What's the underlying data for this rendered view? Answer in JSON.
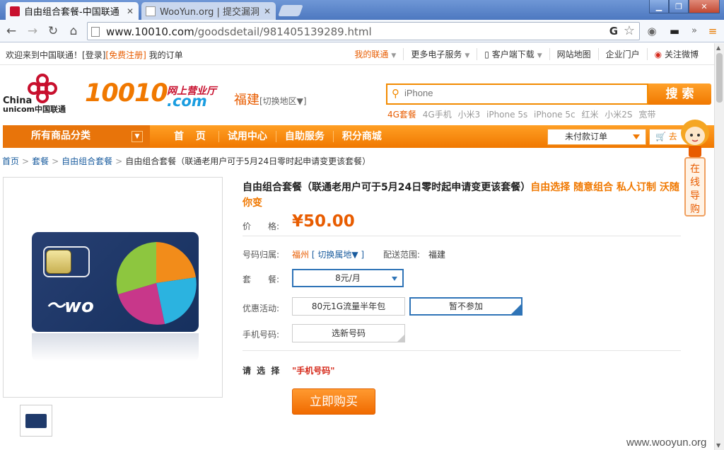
{
  "browser": {
    "tabs": [
      {
        "title": "自由组合套餐-中国联通",
        "active": true
      },
      {
        "title": "WooYun.org | 提交漏洞",
        "active": false
      }
    ],
    "url_host": "www.10010.com",
    "url_path": "/goodsdetail/981405139289.html"
  },
  "site_top": {
    "welcome": "欢迎来到中国联通！",
    "login": "[登录]",
    "register": "[免费注册]",
    "my_orders": "我的订单",
    "links": [
      "我的联通",
      "更多电子服务",
      "客户端下载",
      "网站地图",
      "企业门户",
      "关注微博"
    ]
  },
  "header": {
    "logo_en_1": "China",
    "logo_en_2": "unicom中国联通",
    "logo_number": "10010",
    "logo_sub": "网上营业厅",
    "logo_com": ".com",
    "province": "福建",
    "switch_region": "[切换地区▼]",
    "search_placeholder": "iPhone",
    "search_button": "搜 索",
    "hot_words": [
      "4G套餐",
      "4G手机",
      "小米3",
      "iPhone 5s",
      "iPhone 5c",
      "红米",
      "小米2S",
      "宽带"
    ]
  },
  "nav": {
    "all_categories": "所有商品分类",
    "items": [
      "首 页",
      "试用中心",
      "自助服务",
      "积分商城"
    ],
    "unpaid_orders": "未付款订单",
    "cart": "去"
  },
  "breadcrumb": {
    "items": [
      "首页",
      "套餐",
      "自由组合套餐"
    ],
    "current": "自由组合套餐（联通老用户可于5月24日零时起申请变更该套餐）"
  },
  "product": {
    "title": "自由组合套餐（联通老用户可于5月24日零时起申请变更该套餐）",
    "slogan": "自由选择 随意组合 私人订制 沃随你变",
    "price_label": "价　　格:",
    "price": "¥50.00",
    "location_label": "号码归属:",
    "location": "福州",
    "location_switch": "[ 切换属地▼ ]",
    "shipping_label": "配送范围:",
    "shipping": "福建",
    "plan_label": "套　　餐:",
    "plan_value": "8元/月",
    "promo_label": "优惠活动:",
    "promo_options": [
      "80元1G流量半年包",
      "暂不参加"
    ],
    "phone_label": "手机号码:",
    "phone_button": "选新号码",
    "please_select": "请 选 择",
    "missing": "\"手机号码\"",
    "buy_button": "立即购买"
  },
  "guide": {
    "text": [
      "在",
      "线",
      "导",
      "购"
    ]
  },
  "watermark": "www.wooyun.org",
  "colors": {
    "brand_orange": "#f07800",
    "unicom_red": "#c8102e",
    "link_blue": "#1a5c9e"
  }
}
